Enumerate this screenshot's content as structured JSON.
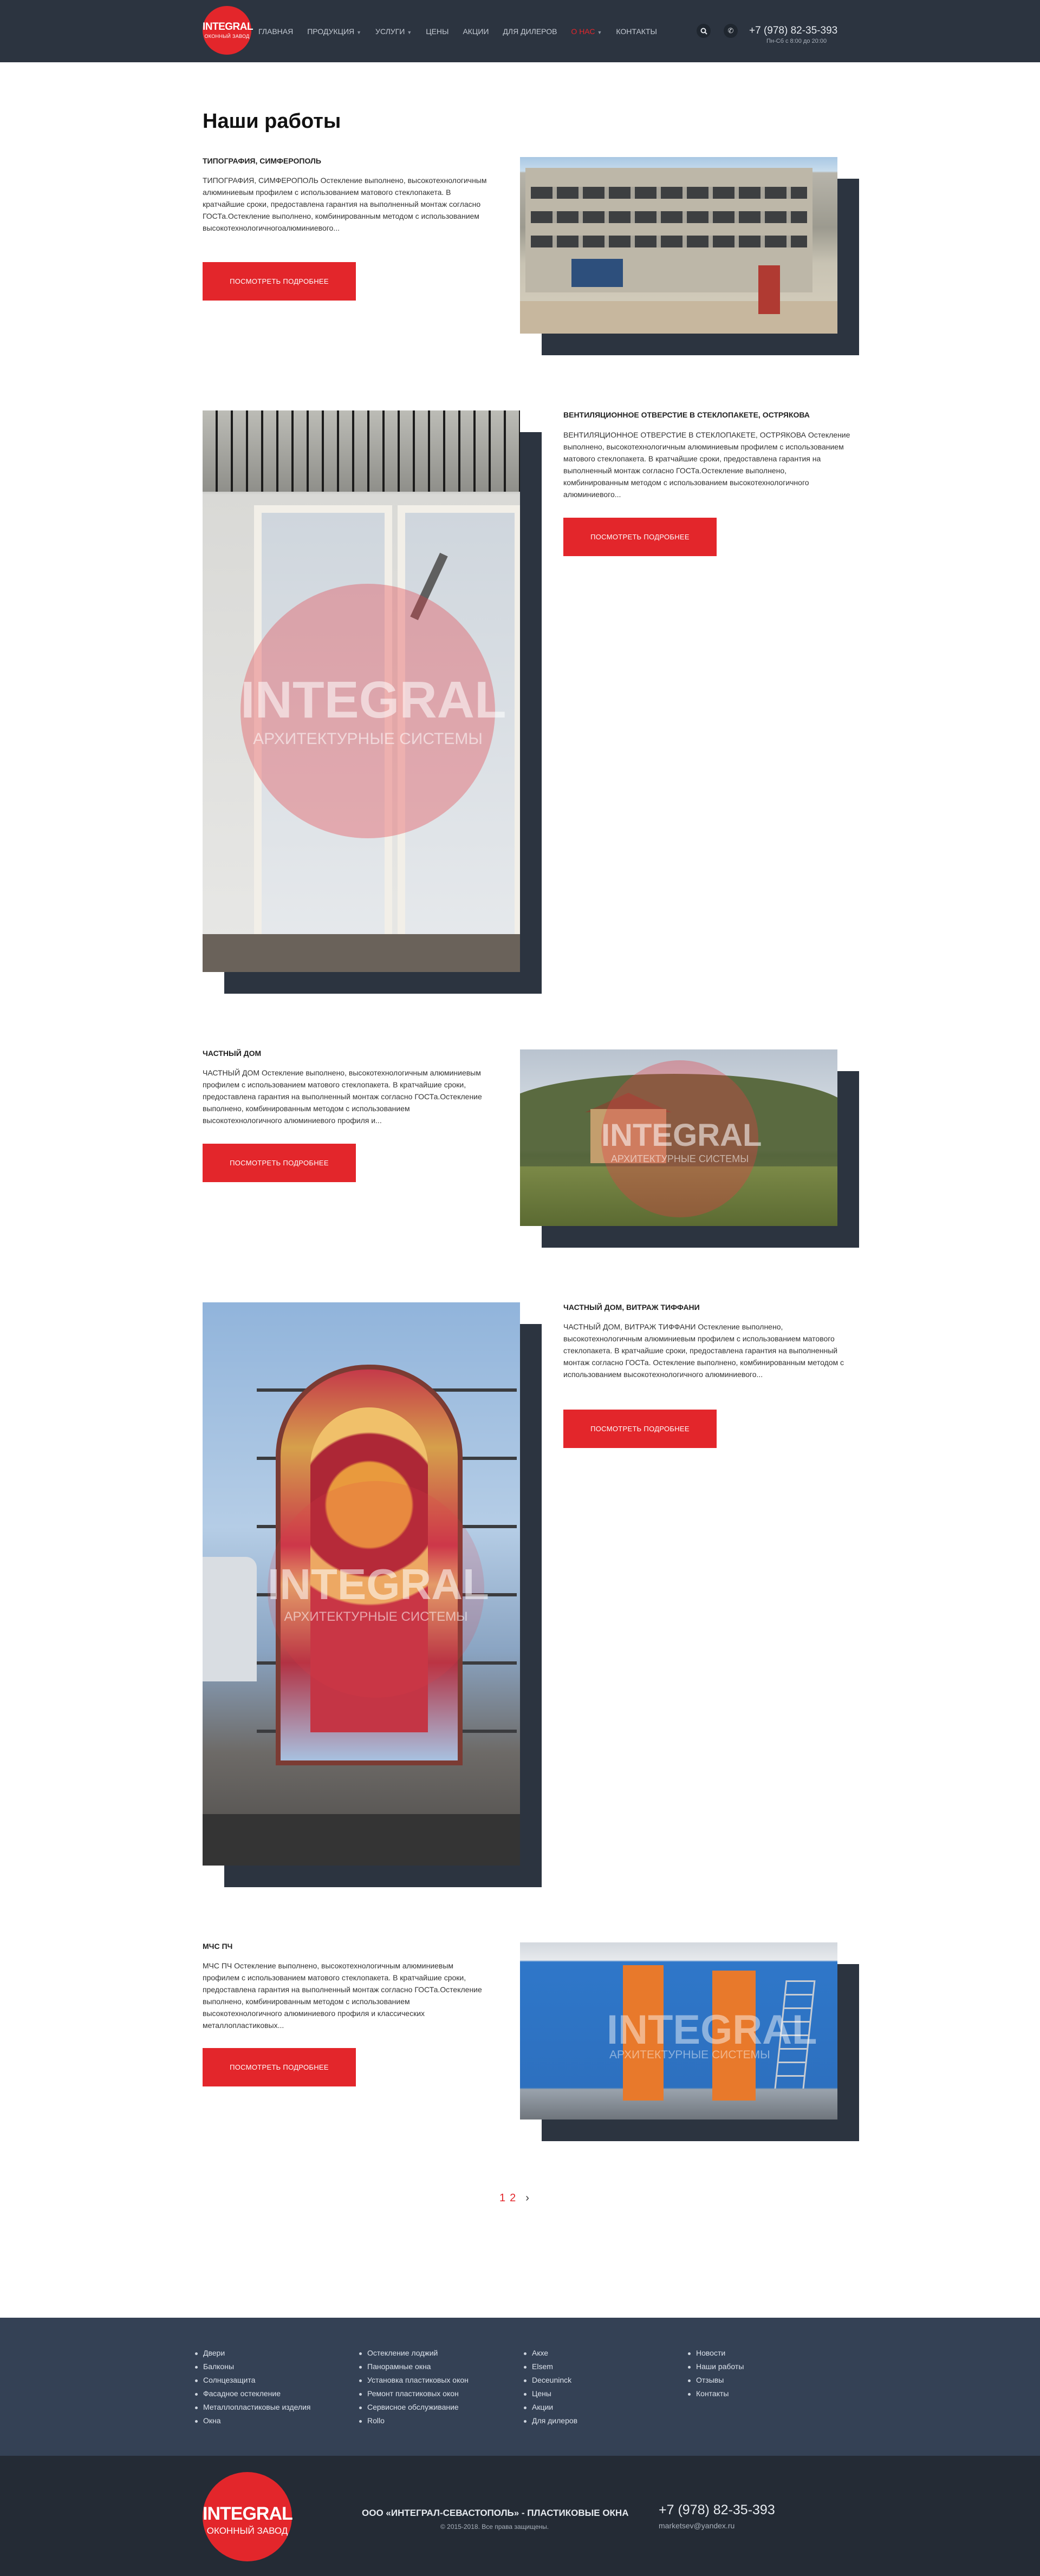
{
  "header": {
    "logo_main": "INTEGRAL",
    "logo_sub": "ОКОННЫЙ ЗАВОД",
    "nav": [
      {
        "label": "ГЛАВНАЯ",
        "has_caret": false
      },
      {
        "label": "ПРОДУКЦИЯ",
        "has_caret": true
      },
      {
        "label": "УСЛУГИ",
        "has_caret": true
      },
      {
        "label": "ЦЕНЫ",
        "has_caret": false
      },
      {
        "label": "АКЦИИ",
        "has_caret": false
      },
      {
        "label": "ДЛЯ ДИЛЕРОВ",
        "has_caret": false
      },
      {
        "label": "О НАС",
        "has_caret": true,
        "active": true
      },
      {
        "label": "КОНТАКТЫ",
        "has_caret": false
      }
    ],
    "search_icon": "search-icon",
    "call_icon": "phone-icon",
    "phone": "+7 (978) 82-35-393",
    "hours": "Пн-Сб с 8:00 до 20:00"
  },
  "main": {
    "title": "Наши работы",
    "button_label": "ПОСМОТРЕТЬ ПОДРОБНЕЕ",
    "works": [
      {
        "title": "ТИПОГРАФИЯ, СИМФЕРОПОЛЬ",
        "description": "ТИПОГРАФИЯ, СИМФЕРОПОЛЬ Остекление выполнено, высокотехнологичным алюминиевым профилем с использованием матового стеклопакета. В кратчайшие сроки, предоставлена гарантия на выполненный монтаж согласно ГОСТа.Остекление выполнено, комбинированным методом с использованием высокотехнологичногоалюминиевого..."
      },
      {
        "title": "ВЕНТИЛЯЦИОННОЕ ОТВЕРСТИЕ В СТЕКЛОПАКЕТЕ, ОСТРЯКОВА",
        "description": "ВЕНТИЛЯЦИОННОЕ ОТВЕРСТИЕ В СТЕКЛОПАКЕТЕ, ОСТРЯКОВА Остекление выполнено, высокотехнологичным алюминиевым профилем с использованием матового стеклопакета. В кратчайшие сроки, предоставлена гарантия на выполненный монтаж согласно ГОСТа.Остекление выполнено, комбинированным методом с использованием высокотехнологичного алюминиевого..."
      },
      {
        "title": "ЧАСТНЫЙ ДОМ",
        "description": "ЧАСТНЫЙ ДОМ Остекление выполнено, высокотехнологичным алюминиевым профилем с использованием матового стеклопакета. В кратчайшие сроки, предоставлена гарантия на выполненный монтаж согласно ГОСТа.Остекление выполнено, комбинированным методом с использованием высокотехнологичного алюминиевого профиля и..."
      },
      {
        "title": "ЧАСТНЫЙ ДОМ, ВИТРАЖ ТИФФАНИ",
        "description": "ЧАСТНЫЙ ДОМ, ВИТРАЖ ТИФФАНИ Остекление выполнено, высокотехнологичным алюминиевым профилем с использованием матового стеклопакета. В кратчайшие сроки, предоставлена гарантия на выполненный монтаж согласно ГОСТа. Остекление выполнено, комбинированным методом с использованием высокотехнологичного алюминиевого..."
      },
      {
        "title": "МЧС ПЧ",
        "description": "МЧС ПЧ Остекление выполнено, высокотехнологичным алюминиевым профилем с использованием матового стеклопакета. В кратчайшие сроки, предоставлена гарантия на выполненный монтаж согласно ГОСТа.Остекление выполнено, комбинированным методом с использованием высокотехнологичного алюминиевого профиля и классических металлопластиковых..."
      }
    ],
    "watermark_main": "INTEGRAL",
    "watermark_sub": "АРХИТЕКТУРНЫЕ СИСТЕМЫ"
  },
  "pagination": {
    "current": "1",
    "other": "2",
    "next": "›"
  },
  "footer": {
    "col1": [
      "Двери",
      "Балконы",
      "Солнцезащита",
      "Фасадное остекление",
      "Металлопластиковые изделия",
      "Окна"
    ],
    "col2": [
      "Остекление лоджий",
      "Панорамные окна",
      "Установка пластиковых окон",
      "Ремонт пластиковых окон",
      "Сервисное обслуживание",
      "Rollo"
    ],
    "col3": [
      "Акхе",
      "Elsem",
      "Deceuninck",
      "Цены",
      "Акции",
      "Для дилеров"
    ],
    "col4": [
      "Новости",
      "Наши работы",
      "Отзывы",
      "Контакты"
    ],
    "logo_main": "INTEGRAL",
    "logo_sub": "ОКОННЫЙ ЗАВОД",
    "company": "ООО «ИНТЕГРАЛ-СЕВАСТОПОЛЬ» - ПЛАСТИКОВЫЕ ОКНА",
    "copyright": "© 2015-2018. Все права защищены.",
    "phone": "+7 (978) 82-35-393",
    "email": "marketsev@yandex.ru"
  },
  "colors": {
    "header_bg": "#2c3440",
    "accent": "#e3262b",
    "footer_top_bg": "#344155",
    "footer_bottom_bg": "#242b35"
  }
}
